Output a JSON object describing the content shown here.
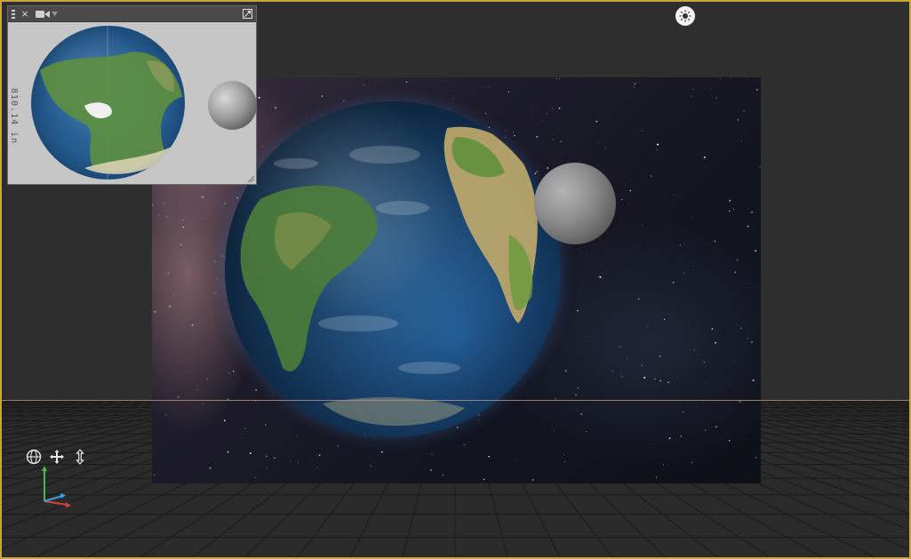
{
  "viewport": {
    "border_color": "#c9a53d",
    "background_color": "#2e2e2e",
    "horizon_color": "#b88c7d"
  },
  "light_button": {
    "icon": "sun-light-icon"
  },
  "gizmo": {
    "items": [
      {
        "icon": "orbit-icon"
      },
      {
        "icon": "pan-icon"
      },
      {
        "icon": "dolly-icon"
      }
    ],
    "axis_colors": {
      "x": "#d9423b",
      "y": "#4ab84a",
      "z": "#3aa0e0"
    }
  },
  "minimap": {
    "title_bar": {
      "menu_icon": "grip-menu-icon",
      "close_label": "×",
      "camera_icon": "video-camera-icon",
      "dropdown_icon": "chevron-down-icon",
      "maximize_icon": "maximize-icon"
    },
    "readout": "810.14 in"
  },
  "scene": {
    "objects": [
      "earth",
      "moon",
      "starfield-backdrop"
    ]
  }
}
